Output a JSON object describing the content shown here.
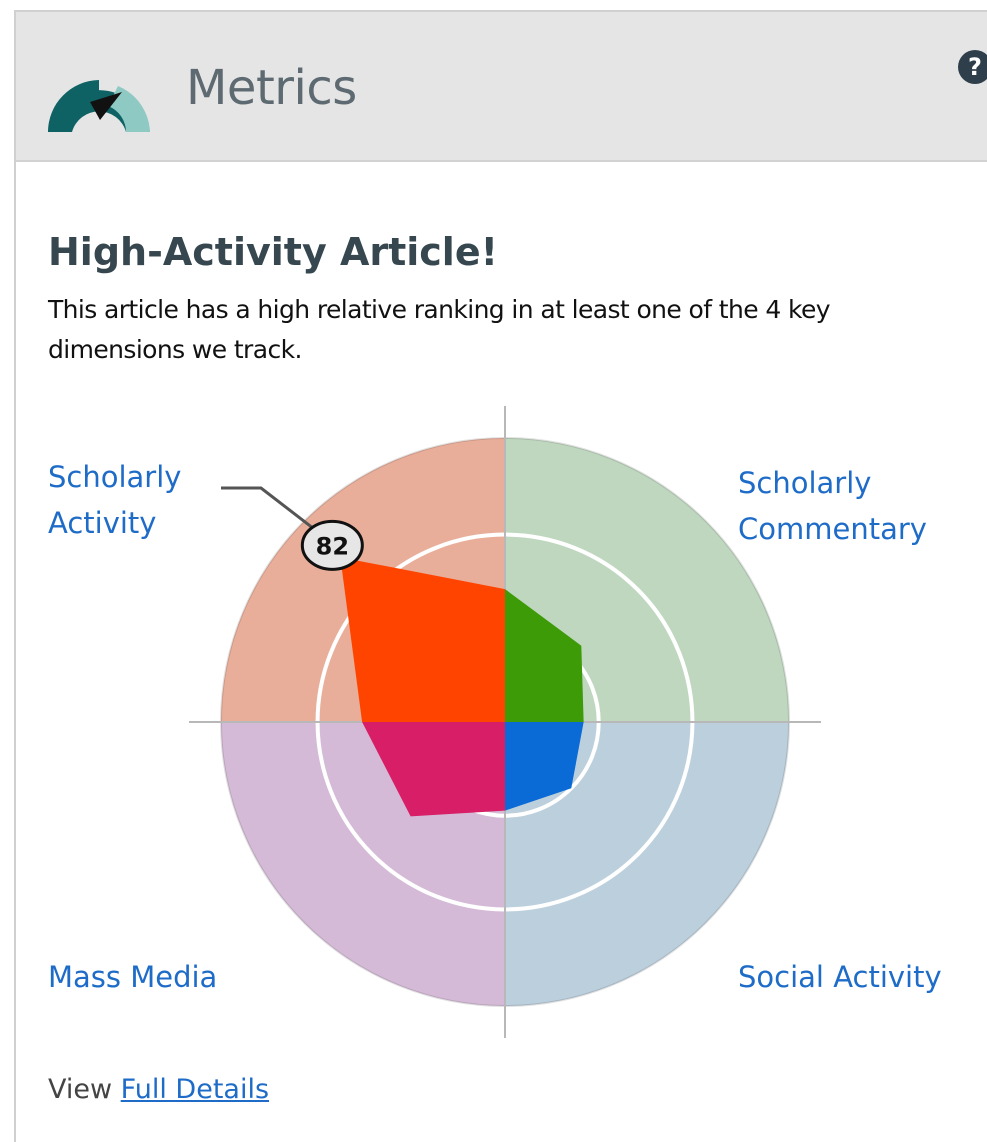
{
  "header": {
    "title": "Metrics",
    "logo_icon": "speedometer-gauge-icon",
    "help_icon": "help-question-icon",
    "help_label": "?"
  },
  "headline": "High-Activity Article!",
  "description": "This article has a high relative ranking in at least  one of the 4 key dimensions we track.",
  "chart_data": {
    "type": "radar-quadrant",
    "scale_max": 100,
    "rings": [
      33,
      66
    ],
    "quadrants": [
      {
        "label": "Scholarly Commentary",
        "position": "top-right",
        "bg_color": "#bfd7bf",
        "fill_color": "#3d9b08",
        "value": 38
      },
      {
        "label": "Social Activity",
        "position": "bottom-right",
        "bg_color": "#bccfdd",
        "fill_color": "#0a6ad6",
        "value": 33
      },
      {
        "label": "Mass Media",
        "position": "bottom-left",
        "bg_color": "#d4bad6",
        "fill_color": "#d71e66",
        "value": 47
      },
      {
        "label": "Scholarly Activity",
        "position": "top-left",
        "bg_color": "#e8ae9a",
        "fill_color": "#ff4400",
        "value": 82
      }
    ],
    "callout": {
      "quadrant": "Scholarly Activity",
      "value": "82"
    }
  },
  "labels": {
    "scholarly_activity": "Scholarly Activity",
    "scholarly_commentary": "Scholarly Commentary",
    "mass_media": "Mass Media",
    "social_activity": "Social Activity"
  },
  "footer": {
    "prefix": "View",
    "link": "Full Details"
  }
}
